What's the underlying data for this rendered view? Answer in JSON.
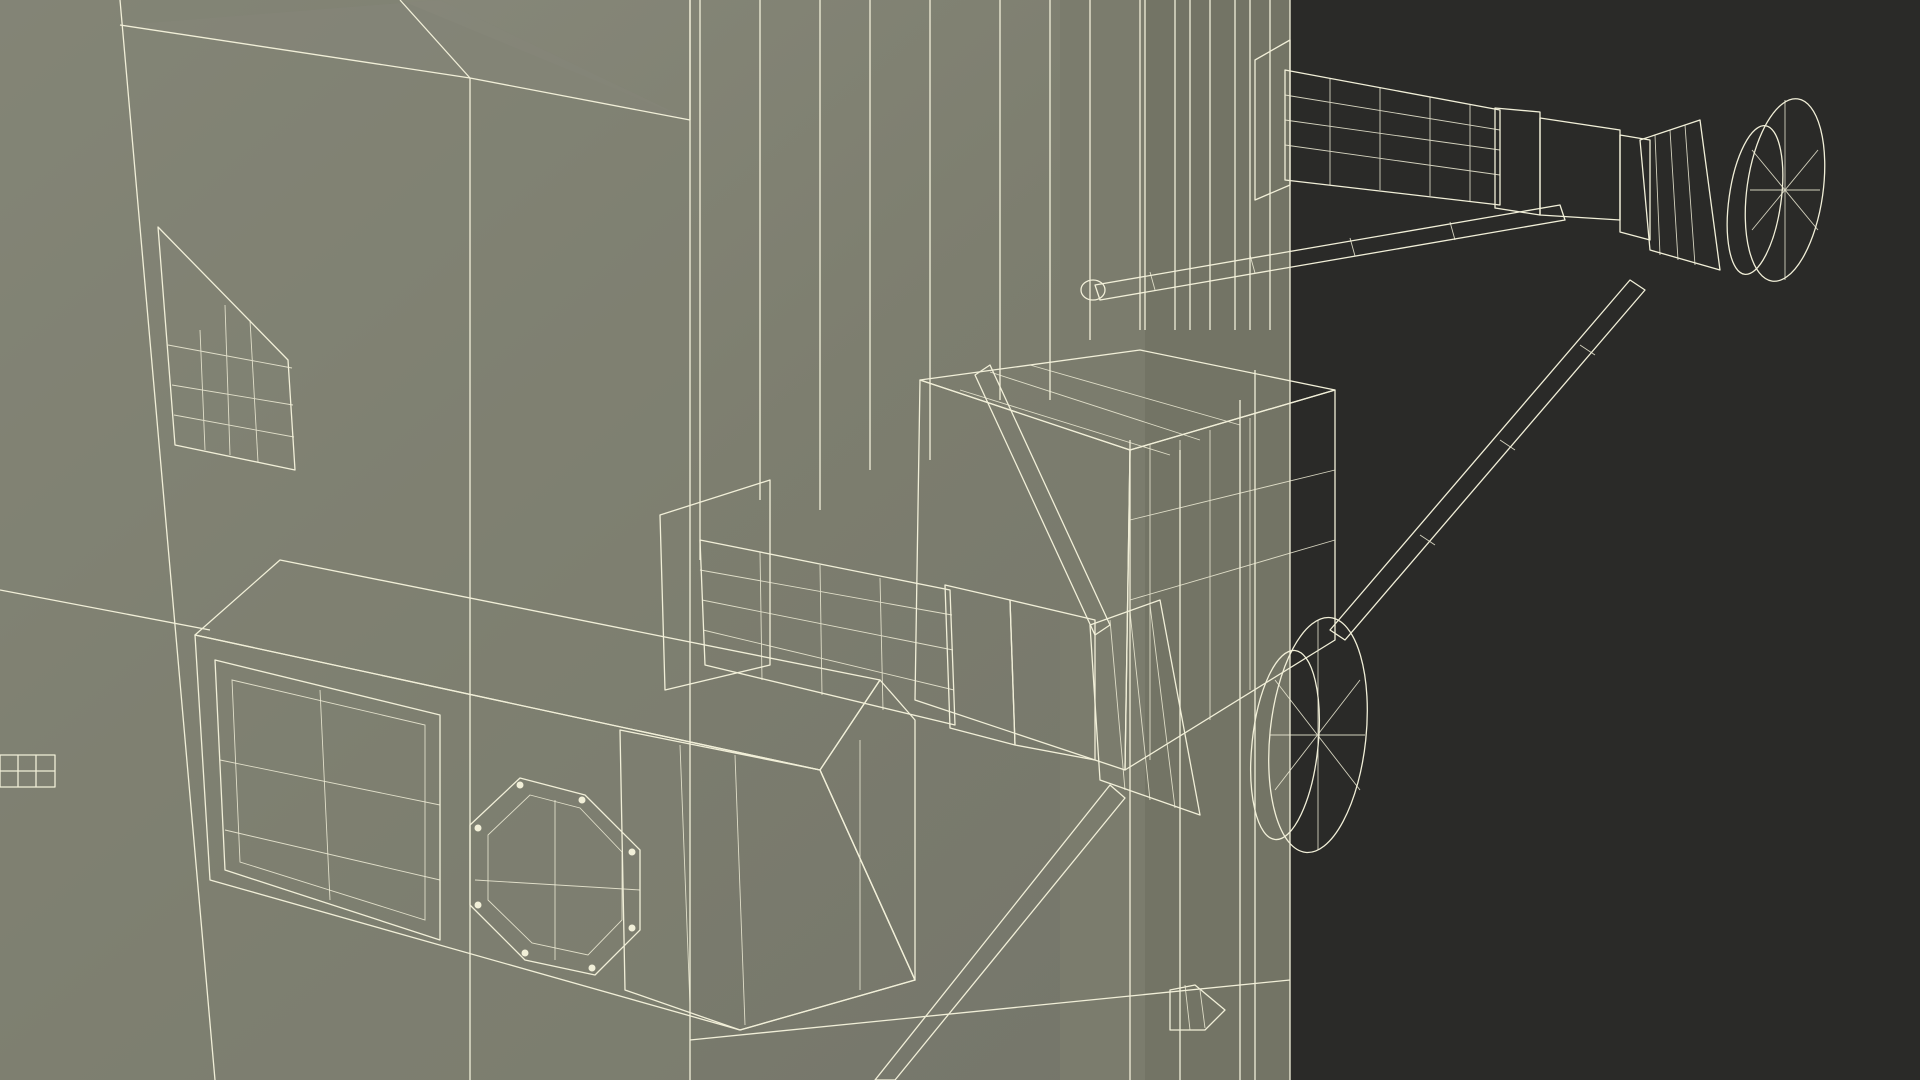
{
  "render": {
    "subject": "wireframe-3d-render",
    "colors": {
      "background": "#2a2a28",
      "surface": "#7a7b6c",
      "surface_dark": "#6e6f60",
      "surface_light": "#86877a",
      "wire": "#f1efd8"
    }
  }
}
